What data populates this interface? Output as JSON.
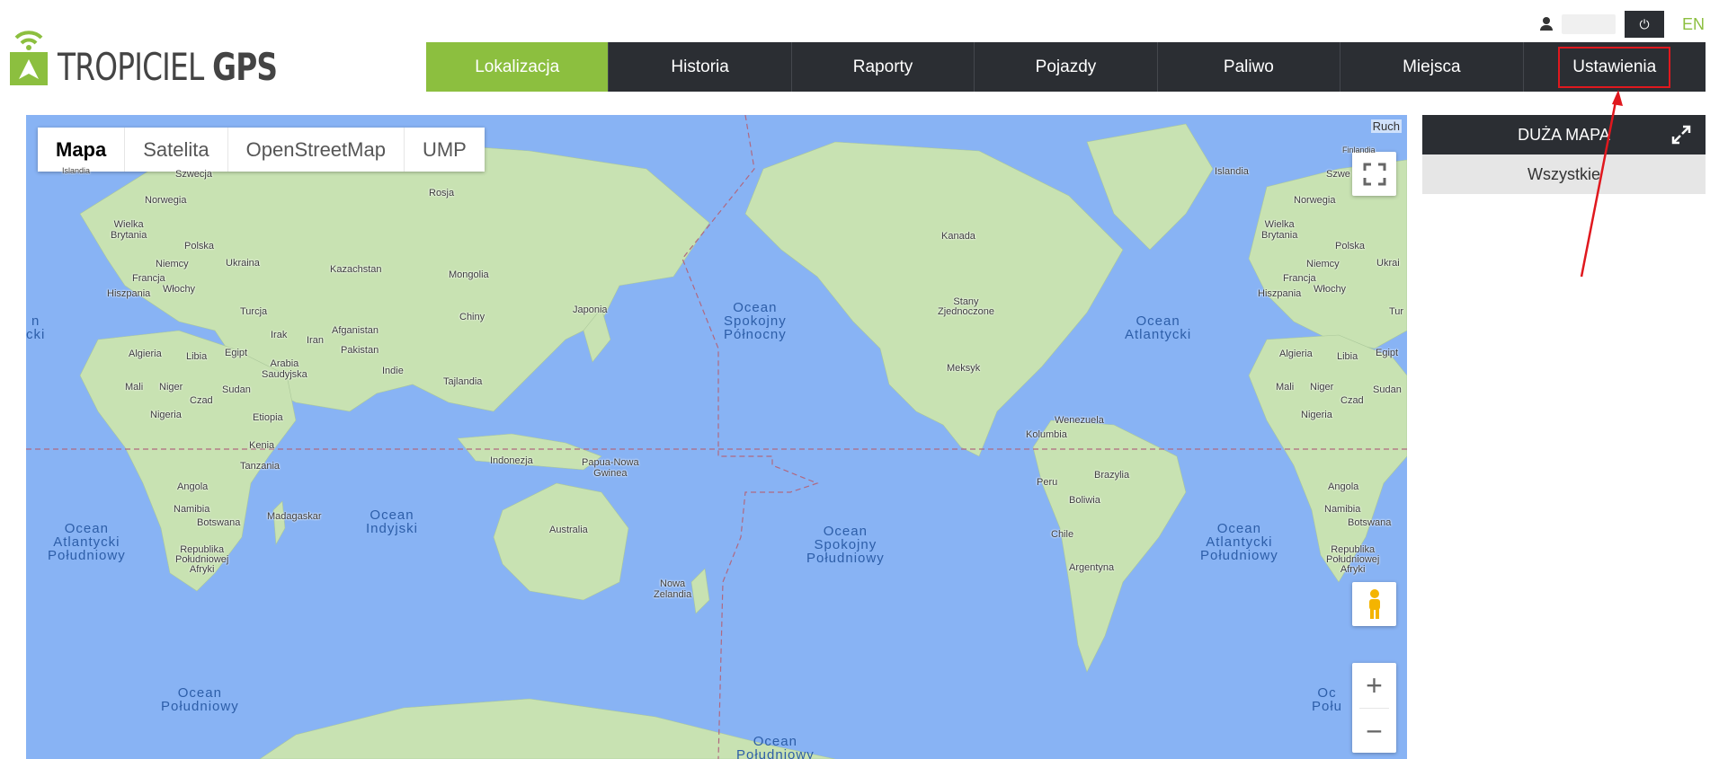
{
  "brand": {
    "name_light": "TROPICIEL",
    "name_bold": "GPS"
  },
  "topbar": {
    "user_icon": "user-icon",
    "power_icon": "power-icon",
    "power_glyph": "⏻",
    "language": "EN"
  },
  "nav": {
    "items": [
      {
        "label": "Lokalizacja"
      },
      {
        "label": "Historia"
      },
      {
        "label": "Raporty"
      },
      {
        "label": "Pojazdy"
      },
      {
        "label": "Paliwo"
      },
      {
        "label": "Miejsca"
      },
      {
        "label": "Ustawienia"
      }
    ],
    "active": "Lokalizacja",
    "highlighted": "Ustawienia"
  },
  "map": {
    "types": [
      "Mapa",
      "Satelita",
      "OpenStreetMap",
      "UMP"
    ],
    "active_type": "Mapa",
    "corner_text": "Ruch",
    "zoom_in": "+",
    "zoom_out": "−",
    "oceans": [
      "Ocean\nSpokojny\nPółnocny",
      "Ocean\nAtlantycki",
      "Ocean\nIndyjski",
      "Ocean\nAtlantycki\nPołudniowy",
      "Ocean\nSpokojny\nPołudniowy",
      "Ocean\nAtlantycki\nPołudniowy",
      "Ocean\nPołudniowy",
      "Ocean\nPołudniowy",
      "Oc\nPołu",
      "n\ncki"
    ],
    "labels": [
      "Islandia",
      "Szwecja",
      "Rosja",
      "Norwegia",
      "Wielka\nBrytania",
      "Polska",
      "Niemcy",
      "Ukraina",
      "Francja",
      "Włochy",
      "Hiszpania",
      "Kazachstan",
      "Mongolia",
      "Turcja",
      "Chiny",
      "Japonia",
      "Irak",
      "Iran",
      "Afganistan",
      "Pakistan",
      "Algieria",
      "Libia",
      "Egipt",
      "Arabia\nSaudyjska",
      "Indie",
      "Tajlandia",
      "Mali",
      "Niger",
      "Sudan",
      "Czad",
      "Nigeria",
      "Etiopia",
      "Kenia",
      "Tanzania",
      "Indonezja",
      "Papua-Nowa\nGwinea",
      "Angola",
      "Namibia",
      "Botswana",
      "Madagaskar",
      "Republika\nPołudniowej\nAfryki",
      "Australia",
      "Nowa\nZelandia",
      "Kanada",
      "Stany\nZjednoczone",
      "Meksyk",
      "Wenezuela",
      "Kolumbia",
      "Brazylia",
      "Peru",
      "Boliwia",
      "Chile",
      "Argentyna",
      "Islandia",
      "Szwe",
      "Norwegia",
      "Wielka\nBrytania",
      "Polska",
      "Niemcy",
      "Ukrai",
      "Francja",
      "Włochy",
      "Hiszpania",
      "Tur",
      "Algieria",
      "Libia",
      "Egipt",
      "Mali",
      "Niger",
      "Sudan",
      "Czad",
      "Nigeria",
      "Angola",
      "Namibia",
      "Botswana",
      "Republika\nPołudniowej\nAfryki",
      "Finlandia"
    ]
  },
  "side": {
    "big_map_label": "DUŻA MAPA",
    "all_label": "Wszystkie"
  },
  "colors": {
    "accent": "#8cbf3f",
    "dark": "#2b2e33",
    "water": "#88b3f4",
    "land": "#c8e2b2",
    "highlight": "#e0181e"
  }
}
